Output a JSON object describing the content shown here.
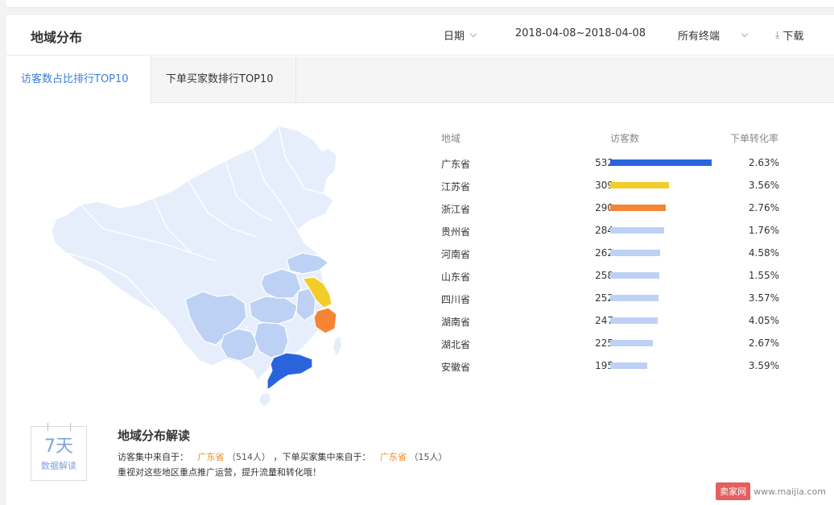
{
  "header": {
    "title": "地域分布",
    "date_label": "日期",
    "date_range": "2018-04-08~2018-04-08",
    "terminal": "所有终端",
    "download": "下载"
  },
  "tabs": [
    {
      "label": "访客数占比排行TOP10"
    },
    {
      "label": "下单买家数排行TOP10"
    }
  ],
  "table": {
    "col_region": "地域",
    "col_visitors": "访客数",
    "col_rate": "下单转化率",
    "rows": [
      {
        "province": "广东省",
        "visitors": "532",
        "rate": "2.63%",
        "value": 532,
        "color": "#2a64dd"
      },
      {
        "province": "江苏省",
        "visitors": "309",
        "rate": "3.56%",
        "value": 309,
        "color": "#f2cd2a"
      },
      {
        "province": "浙江省",
        "visitors": "290",
        "rate": "2.76%",
        "value": 290,
        "color": "#f68435"
      },
      {
        "province": "贵州省",
        "visitors": "284",
        "rate": "1.76%",
        "value": 284,
        "color": "#bdd1f5"
      },
      {
        "province": "河南省",
        "visitors": "262",
        "rate": "4.58%",
        "value": 262,
        "color": "#bdd1f5"
      },
      {
        "province": "山东省",
        "visitors": "258",
        "rate": "1.55%",
        "value": 258,
        "color": "#bdd1f5"
      },
      {
        "province": "四川省",
        "visitors": "252",
        "rate": "3.57%",
        "value": 252,
        "color": "#bdd1f5"
      },
      {
        "province": "湖南省",
        "visitors": "247",
        "rate": "4.05%",
        "value": 247,
        "color": "#bdd1f5"
      },
      {
        "province": "湖北省",
        "visitors": "225",
        "rate": "2.67%",
        "value": 225,
        "color": "#bdd1f5"
      },
      {
        "province": "安徽省",
        "visitors": "195",
        "rate": "3.59%",
        "value": 195,
        "color": "#bdd1f5"
      }
    ]
  },
  "badge": {
    "big": "7天",
    "small": "数据解读"
  },
  "interpretation": {
    "title": "地域分布解读",
    "visitor_prefix": "访客集中来自于：",
    "visitor_province": "广东省",
    "visitor_count": "（514人）",
    "buyer_prefix": "，下单买家集中来自于：",
    "buyer_province": "广东省",
    "buyer_count": "（15人）",
    "advice": "重视对这些地区重点推广运营，提升流量和转化哦！"
  },
  "watermark": {
    "badge": "卖家网",
    "url": "www.maijia.com"
  },
  "colors": {
    "accent": "#3a7fd8",
    "highlight": "#f08a24",
    "map_base": "#e6eefb",
    "map_mid": "#bdd1f5"
  }
}
